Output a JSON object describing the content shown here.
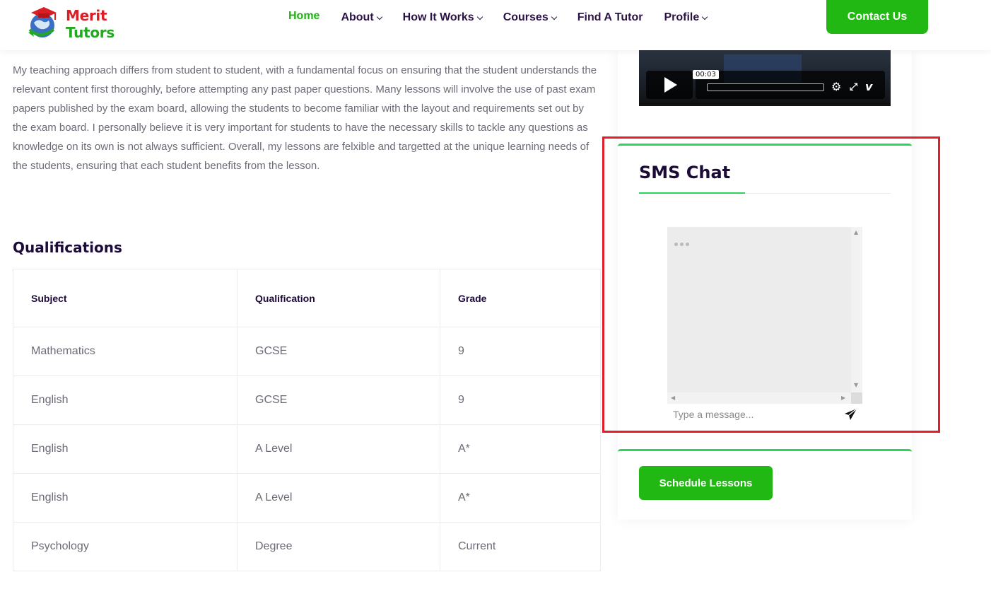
{
  "header": {
    "logo_text": "Merit Tutors",
    "logo_word1": "Merit",
    "logo_word2": "Tutors",
    "nav": [
      {
        "label": "Home",
        "active": true,
        "dropdown": false
      },
      {
        "label": "About",
        "dropdown": true
      },
      {
        "label": "How It Works",
        "dropdown": true
      },
      {
        "label": "Courses",
        "dropdown": true
      },
      {
        "label": "Find A Tutor",
        "dropdown": false
      },
      {
        "label": "Profile",
        "dropdown": true
      }
    ],
    "contact_label": "Contact Us"
  },
  "bio": {
    "text": "My teaching approach differs from student to student, with a fundamental focus on ensuring that the student understands the relevant content first thoroughly, before attempting any past paper questions. Many lessons will involve the use of past exam papers published by the exam board, allowing the students to become familiar with the layout and requirements set out by the exam board. I personally believe it is very important for students to have the necessary skills to tackle any questions as knowledge on its own is not always sufficient. Overall, my lessons are felxible and targetted at the unique learning needs of the students, ensuring that each student benefits from the lesson."
  },
  "qualifications": {
    "title": "Qualifications",
    "columns": [
      "Subject",
      "Qualification",
      "Grade"
    ],
    "rows": [
      [
        "Mathematics",
        "GCSE",
        "9"
      ],
      [
        "English",
        "GCSE",
        "9"
      ],
      [
        "English",
        "A Level",
        "A*"
      ],
      [
        "English",
        "A Level",
        "A*"
      ],
      [
        "Psychology",
        "Degree",
        "Current"
      ]
    ]
  },
  "video": {
    "time": "00:03",
    "icons": [
      "play-icon",
      "settings-icon",
      "fullscreen-icon",
      "vimeo-icon"
    ]
  },
  "chat": {
    "title": "SMS Chat",
    "input_placeholder": "Type a message...",
    "accent_color": "#2bd45b"
  },
  "schedule": {
    "button_label": "Schedule Lessons"
  },
  "colors": {
    "brand_green": "#22b814",
    "nav_text": "#2a1446",
    "highlight_red": "#e11d2a"
  }
}
